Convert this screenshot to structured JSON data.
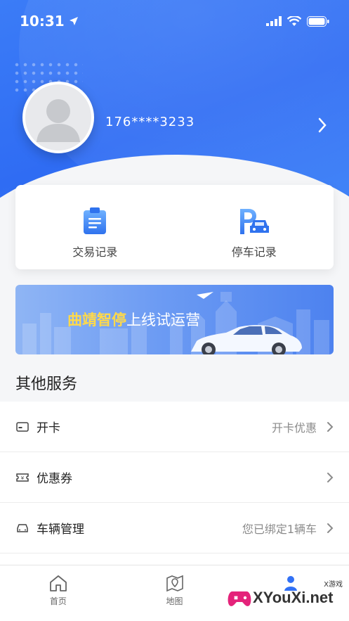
{
  "status_bar": {
    "time": "10:31"
  },
  "profile": {
    "phone": "176****3233"
  },
  "records": [
    {
      "label": "交易记录",
      "icon": "clipboard-icon"
    },
    {
      "label": "停车记录",
      "icon": "parking-car-icon"
    }
  ],
  "banner": {
    "highlight": "曲靖智停",
    "rest": "上线试运营"
  },
  "services": {
    "title": "其他服务",
    "items": [
      {
        "label": "开卡",
        "value": "开卡优惠",
        "icon": "card-icon"
      },
      {
        "label": "优惠券",
        "value": "",
        "icon": "coupon-icon"
      },
      {
        "label": "车辆管理",
        "value": "您已绑定1辆车",
        "icon": "car-icon"
      }
    ]
  },
  "tabs": [
    {
      "label": "首页",
      "icon": "home-icon"
    },
    {
      "label": "地图",
      "icon": "map-pin-icon"
    }
  ],
  "watermark": {
    "text": "XYouXi.net",
    "small": "X游戏"
  },
  "colors": {
    "primary": "#3271f5",
    "accent": "#ffd94a"
  }
}
